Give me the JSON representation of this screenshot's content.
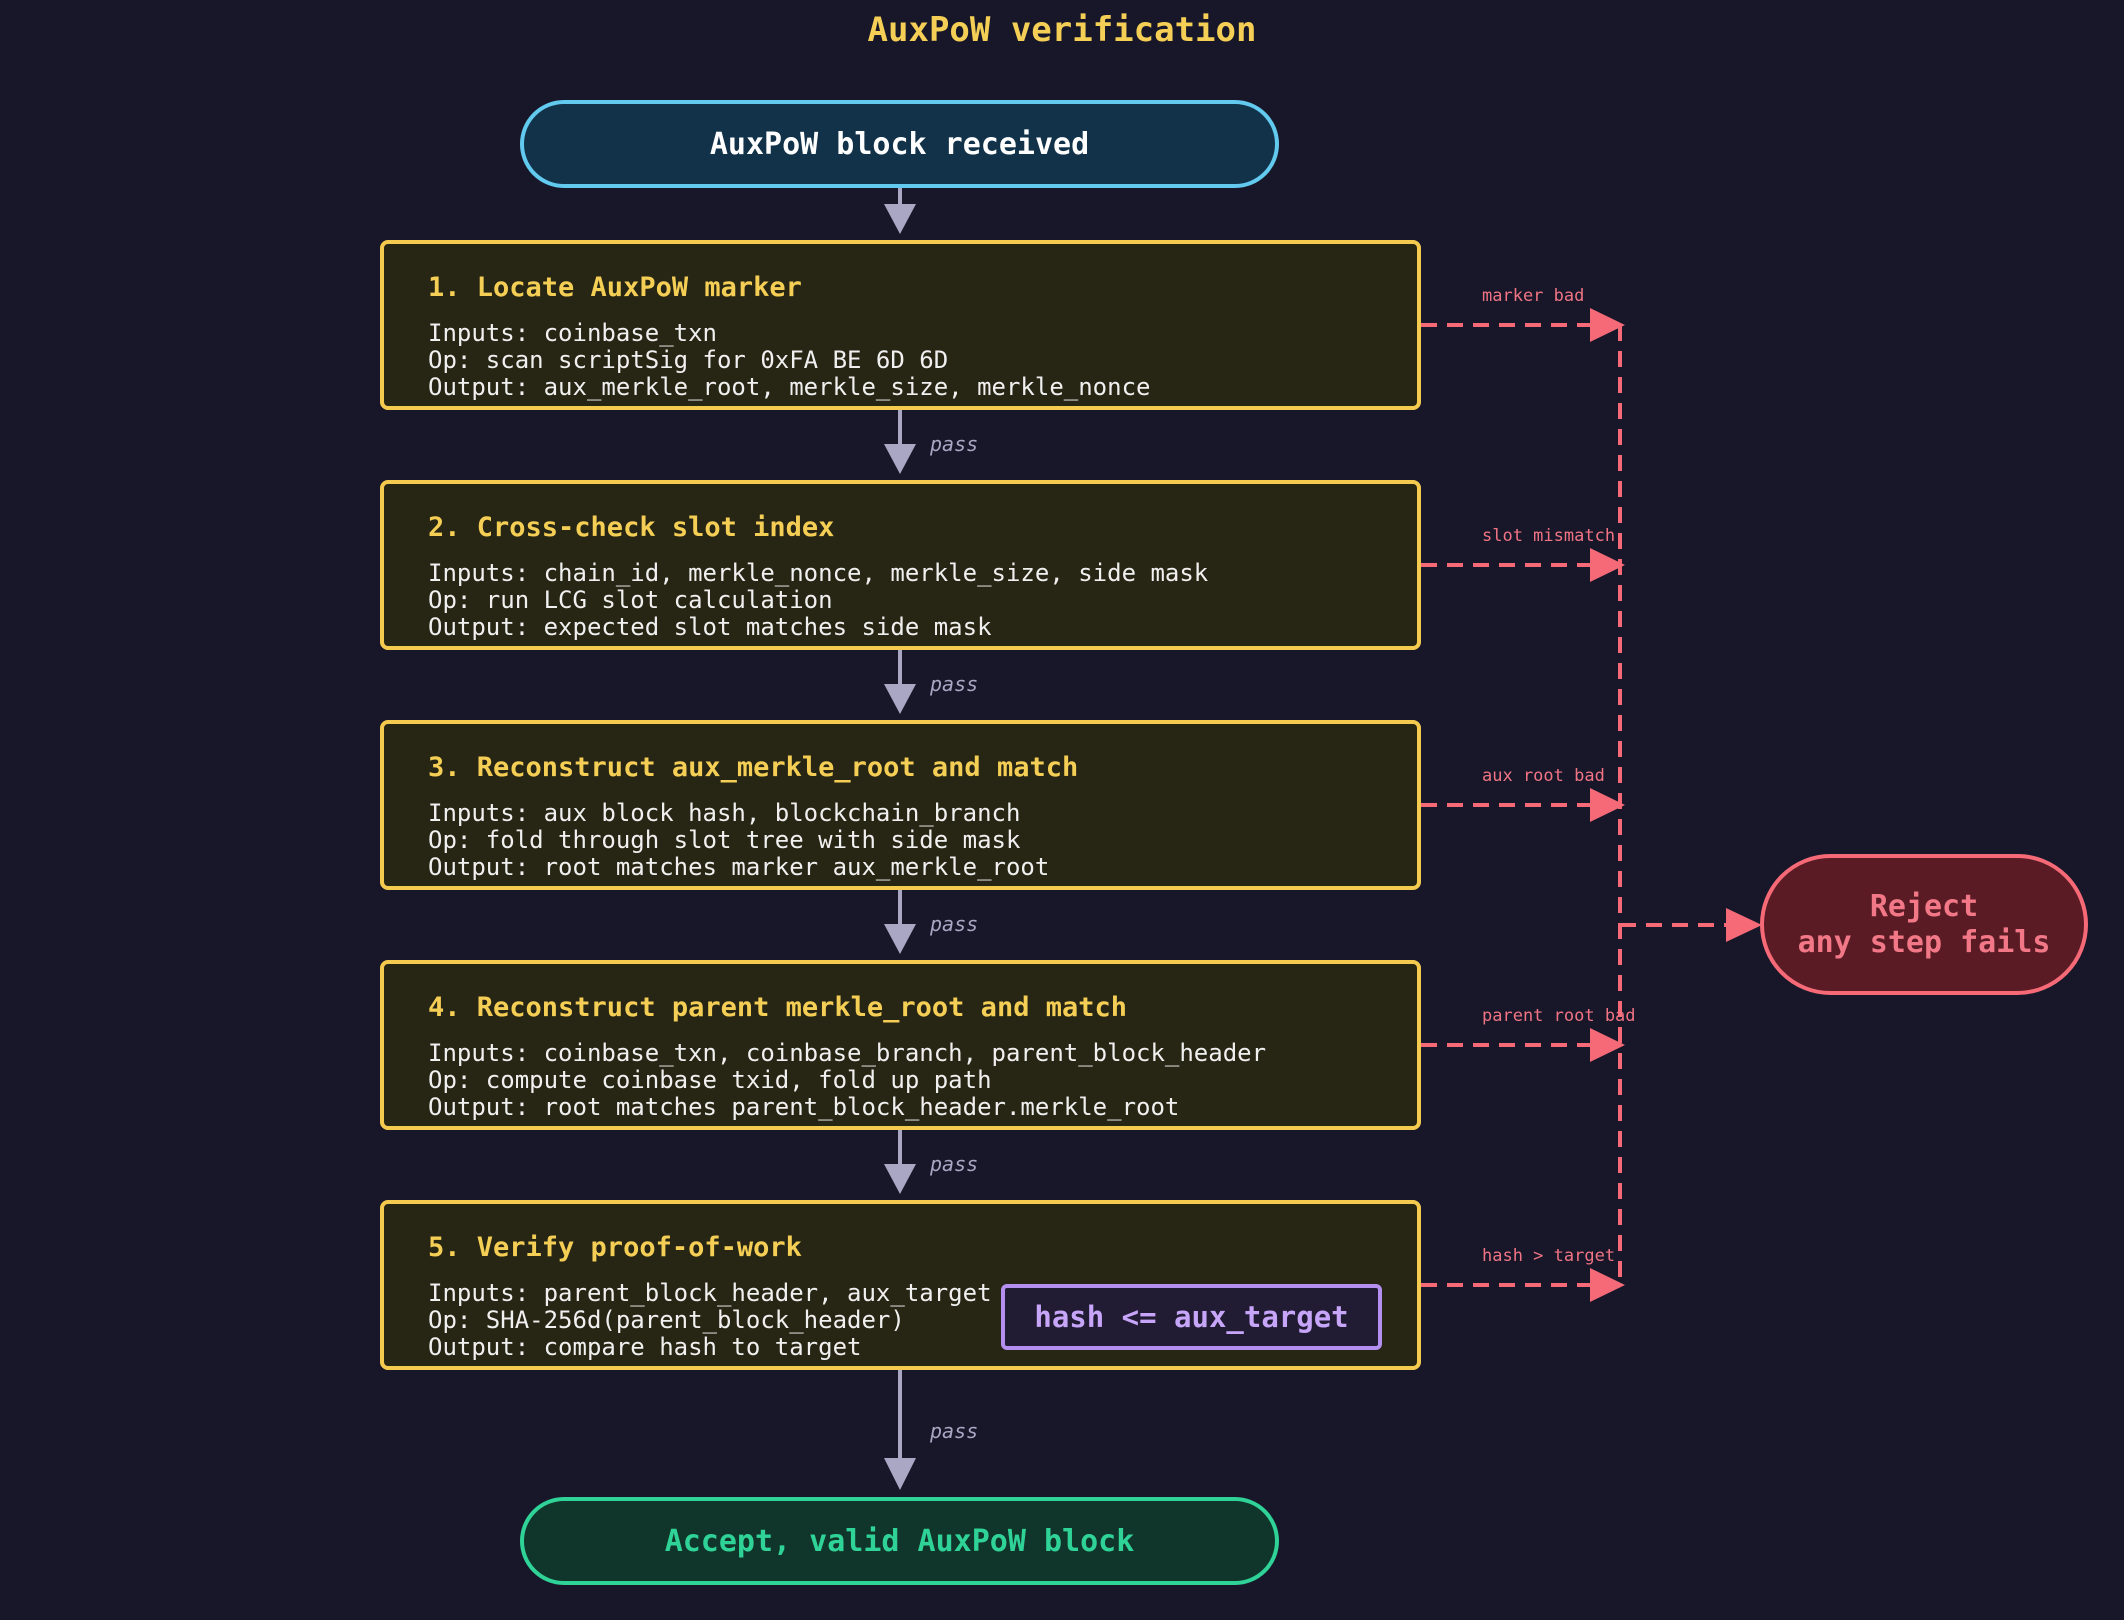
{
  "diagram": {
    "title": "AuxPoW verification",
    "start_node": "AuxPoW block received",
    "steps": [
      {
        "title": "1. Locate AuxPoW marker",
        "inputs": "Inputs: coinbase_txn",
        "op": "Op: scan scriptSig for 0xFA BE 6D 6D",
        "output": "Output: aux_merkle_root, merkle_size, merkle_nonce",
        "fail_label": "marker bad"
      },
      {
        "title": "2. Cross-check slot index",
        "inputs": "Inputs: chain_id, merkle_nonce, merkle_size, side mask",
        "op": "Op: run LCG slot calculation",
        "output": "Output: expected slot matches side mask",
        "fail_label": "slot mismatch"
      },
      {
        "title": "3. Reconstruct aux_merkle_root and match",
        "inputs": "Inputs: aux block hash, blockchain_branch",
        "op": "Op: fold through slot tree with side mask",
        "output": "Output: root matches marker aux_merkle_root",
        "fail_label": "aux root bad"
      },
      {
        "title": "4. Reconstruct parent merkle_root and match",
        "inputs": "Inputs: coinbase_txn, coinbase_branch, parent_block_header",
        "op": "Op: compute coinbase txid, fold up path",
        "output": "Output: root matches parent_block_header.merkle_root",
        "fail_label": "parent root bad"
      },
      {
        "title": "5. Verify proof-of-work",
        "inputs": "Inputs: parent_block_header, aux_target",
        "op": "Op: SHA-256d(parent_block_header)",
        "output": "Output: compare hash to target",
        "condition": "hash <= aux_target",
        "fail_label": "hash > target"
      }
    ],
    "pass_label": "pass",
    "reject_node": {
      "line1": "Reject",
      "line2": "any step fails"
    },
    "accept_node": "Accept, valid AuxPoW block",
    "colors": {
      "background": "#171729",
      "step_border": "#f5cb4f",
      "fail": "#f56a76",
      "pass_arrow": "#a9a7c4",
      "accept": "#2fd397",
      "start": "#62c9ef",
      "condition": "#b48ff0"
    }
  }
}
